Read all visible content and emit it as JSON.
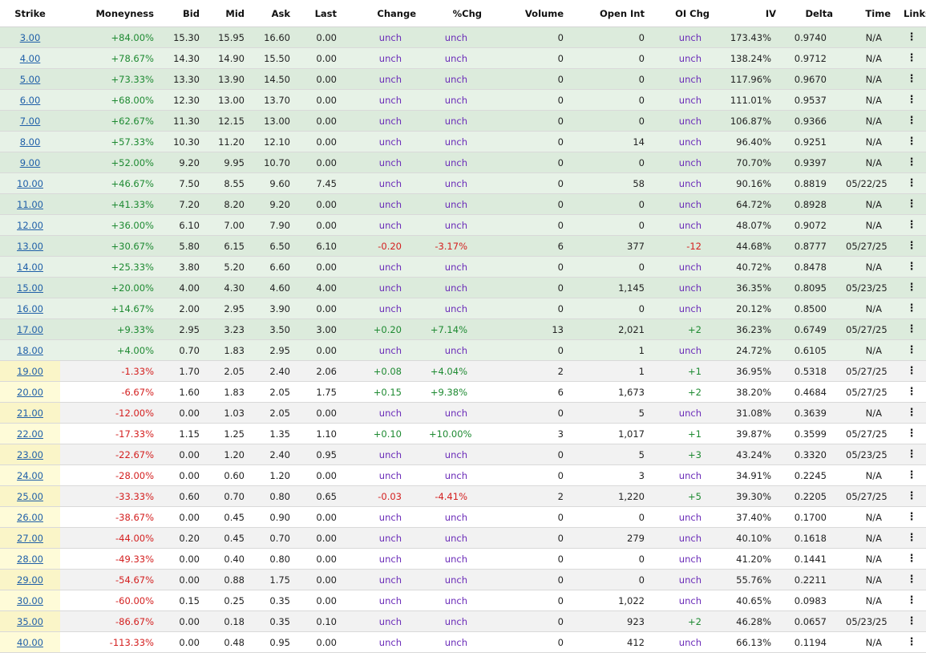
{
  "colors": {
    "positive": "#1e8a32",
    "negative": "#d42020",
    "unchanged": "#6a2bb8",
    "link": "#1f5fa8",
    "itm_bg": "#e7f2e7",
    "otm_strike_bg": "#fefbd8"
  },
  "columns": [
    "Strike",
    "Moneyness",
    "Bid",
    "Mid",
    "Ask",
    "Last",
    "Change",
    "%Chg",
    "Volume",
    "Open Int",
    "OI Chg",
    "IV",
    "Delta",
    "Time",
    "Links"
  ],
  "links_icon": "vertical-ellipsis-icon",
  "rows": [
    {
      "strike": "3.00",
      "moneyness": "+84.00%",
      "bid": "15.30",
      "mid": "15.95",
      "ask": "16.60",
      "last": "0.00",
      "change": "unch",
      "pct_chg": "unch",
      "volume": "0",
      "open_int": "0",
      "oi_chg": "unch",
      "iv": "173.43%",
      "delta": "0.9740",
      "time": "N/A",
      "links": "⋮"
    },
    {
      "strike": "4.00",
      "moneyness": "+78.67%",
      "bid": "14.30",
      "mid": "14.90",
      "ask": "15.50",
      "last": "0.00",
      "change": "unch",
      "pct_chg": "unch",
      "volume": "0",
      "open_int": "0",
      "oi_chg": "unch",
      "iv": "138.24%",
      "delta": "0.9712",
      "time": "N/A",
      "links": "⋮"
    },
    {
      "strike": "5.00",
      "moneyness": "+73.33%",
      "bid": "13.30",
      "mid": "13.90",
      "ask": "14.50",
      "last": "0.00",
      "change": "unch",
      "pct_chg": "unch",
      "volume": "0",
      "open_int": "0",
      "oi_chg": "unch",
      "iv": "117.96%",
      "delta": "0.9670",
      "time": "N/A",
      "links": "⋮"
    },
    {
      "strike": "6.00",
      "moneyness": "+68.00%",
      "bid": "12.30",
      "mid": "13.00",
      "ask": "13.70",
      "last": "0.00",
      "change": "unch",
      "pct_chg": "unch",
      "volume": "0",
      "open_int": "0",
      "oi_chg": "unch",
      "iv": "111.01%",
      "delta": "0.9537",
      "time": "N/A",
      "links": "⋮"
    },
    {
      "strike": "7.00",
      "moneyness": "+62.67%",
      "bid": "11.30",
      "mid": "12.15",
      "ask": "13.00",
      "last": "0.00",
      "change": "unch",
      "pct_chg": "unch",
      "volume": "0",
      "open_int": "0",
      "oi_chg": "unch",
      "iv": "106.87%",
      "delta": "0.9366",
      "time": "N/A",
      "links": "⋮"
    },
    {
      "strike": "8.00",
      "moneyness": "+57.33%",
      "bid": "10.30",
      "mid": "11.20",
      "ask": "12.10",
      "last": "0.00",
      "change": "unch",
      "pct_chg": "unch",
      "volume": "0",
      "open_int": "14",
      "oi_chg": "unch",
      "iv": "96.40%",
      "delta": "0.9251",
      "time": "N/A",
      "links": "⋮"
    },
    {
      "strike": "9.00",
      "moneyness": "+52.00%",
      "bid": "9.20",
      "mid": "9.95",
      "ask": "10.70",
      "last": "0.00",
      "change": "unch",
      "pct_chg": "unch",
      "volume": "0",
      "open_int": "0",
      "oi_chg": "unch",
      "iv": "70.70%",
      "delta": "0.9397",
      "time": "N/A",
      "links": "⋮"
    },
    {
      "strike": "10.00",
      "moneyness": "+46.67%",
      "bid": "7.50",
      "mid": "8.55",
      "ask": "9.60",
      "last": "7.45",
      "change": "unch",
      "pct_chg": "unch",
      "volume": "0",
      "open_int": "58",
      "oi_chg": "unch",
      "iv": "90.16%",
      "delta": "0.8819",
      "time": "05/22/25",
      "links": "⋮"
    },
    {
      "strike": "11.00",
      "moneyness": "+41.33%",
      "bid": "7.20",
      "mid": "8.20",
      "ask": "9.20",
      "last": "0.00",
      "change": "unch",
      "pct_chg": "unch",
      "volume": "0",
      "open_int": "0",
      "oi_chg": "unch",
      "iv": "64.72%",
      "delta": "0.8928",
      "time": "N/A",
      "links": "⋮"
    },
    {
      "strike": "12.00",
      "moneyness": "+36.00%",
      "bid": "6.10",
      "mid": "7.00",
      "ask": "7.90",
      "last": "0.00",
      "change": "unch",
      "pct_chg": "unch",
      "volume": "0",
      "open_int": "0",
      "oi_chg": "unch",
      "iv": "48.07%",
      "delta": "0.9072",
      "time": "N/A",
      "links": "⋮"
    },
    {
      "strike": "13.00",
      "moneyness": "+30.67%",
      "bid": "5.80",
      "mid": "6.15",
      "ask": "6.50",
      "last": "6.10",
      "change": "-0.20",
      "pct_chg": "-3.17%",
      "volume": "6",
      "open_int": "377",
      "oi_chg": "-12",
      "iv": "44.68%",
      "delta": "0.8777",
      "time": "05/27/25",
      "links": "⋮"
    },
    {
      "strike": "14.00",
      "moneyness": "+25.33%",
      "bid": "3.80",
      "mid": "5.20",
      "ask": "6.60",
      "last": "0.00",
      "change": "unch",
      "pct_chg": "unch",
      "volume": "0",
      "open_int": "0",
      "oi_chg": "unch",
      "iv": "40.72%",
      "delta": "0.8478",
      "time": "N/A",
      "links": "⋮"
    },
    {
      "strike": "15.00",
      "moneyness": "+20.00%",
      "bid": "4.00",
      "mid": "4.30",
      "ask": "4.60",
      "last": "4.00",
      "change": "unch",
      "pct_chg": "unch",
      "volume": "0",
      "open_int": "1,145",
      "oi_chg": "unch",
      "iv": "36.35%",
      "delta": "0.8095",
      "time": "05/23/25",
      "links": "⋮"
    },
    {
      "strike": "16.00",
      "moneyness": "+14.67%",
      "bid": "2.00",
      "mid": "2.95",
      "ask": "3.90",
      "last": "0.00",
      "change": "unch",
      "pct_chg": "unch",
      "volume": "0",
      "open_int": "0",
      "oi_chg": "unch",
      "iv": "20.12%",
      "delta": "0.8500",
      "time": "N/A",
      "links": "⋮"
    },
    {
      "strike": "17.00",
      "moneyness": "+9.33%",
      "bid": "2.95",
      "mid": "3.23",
      "ask": "3.50",
      "last": "3.00",
      "change": "+0.20",
      "pct_chg": "+7.14%",
      "volume": "13",
      "open_int": "2,021",
      "oi_chg": "+2",
      "iv": "36.23%",
      "delta": "0.6749",
      "time": "05/27/25",
      "links": "⋮"
    },
    {
      "strike": "18.00",
      "moneyness": "+4.00%",
      "bid": "0.70",
      "mid": "1.83",
      "ask": "2.95",
      "last": "0.00",
      "change": "unch",
      "pct_chg": "unch",
      "volume": "0",
      "open_int": "1",
      "oi_chg": "unch",
      "iv": "24.72%",
      "delta": "0.6105",
      "time": "N/A",
      "links": "⋮"
    },
    {
      "strike": "19.00",
      "moneyness": "-1.33%",
      "bid": "1.70",
      "mid": "2.05",
      "ask": "2.40",
      "last": "2.06",
      "change": "+0.08",
      "pct_chg": "+4.04%",
      "volume": "2",
      "open_int": "1",
      "oi_chg": "+1",
      "iv": "36.95%",
      "delta": "0.5318",
      "time": "05/27/25",
      "links": "⋮"
    },
    {
      "strike": "20.00",
      "moneyness": "-6.67%",
      "bid": "1.60",
      "mid": "1.83",
      "ask": "2.05",
      "last": "1.75",
      "change": "+0.15",
      "pct_chg": "+9.38%",
      "volume": "6",
      "open_int": "1,673",
      "oi_chg": "+2",
      "iv": "38.20%",
      "delta": "0.4684",
      "time": "05/27/25",
      "links": "⋮"
    },
    {
      "strike": "21.00",
      "moneyness": "-12.00%",
      "bid": "0.00",
      "mid": "1.03",
      "ask": "2.05",
      "last": "0.00",
      "change": "unch",
      "pct_chg": "unch",
      "volume": "0",
      "open_int": "5",
      "oi_chg": "unch",
      "iv": "31.08%",
      "delta": "0.3639",
      "time": "N/A",
      "links": "⋮"
    },
    {
      "strike": "22.00",
      "moneyness": "-17.33%",
      "bid": "1.15",
      "mid": "1.25",
      "ask": "1.35",
      "last": "1.10",
      "change": "+0.10",
      "pct_chg": "+10.00%",
      "volume": "3",
      "open_int": "1,017",
      "oi_chg": "+1",
      "iv": "39.87%",
      "delta": "0.3599",
      "time": "05/27/25",
      "links": "⋮"
    },
    {
      "strike": "23.00",
      "moneyness": "-22.67%",
      "bid": "0.00",
      "mid": "1.20",
      "ask": "2.40",
      "last": "0.95",
      "change": "unch",
      "pct_chg": "unch",
      "volume": "0",
      "open_int": "5",
      "oi_chg": "+3",
      "iv": "43.24%",
      "delta": "0.3320",
      "time": "05/23/25",
      "links": "⋮"
    },
    {
      "strike": "24.00",
      "moneyness": "-28.00%",
      "bid": "0.00",
      "mid": "0.60",
      "ask": "1.20",
      "last": "0.00",
      "change": "unch",
      "pct_chg": "unch",
      "volume": "0",
      "open_int": "3",
      "oi_chg": "unch",
      "iv": "34.91%",
      "delta": "0.2245",
      "time": "N/A",
      "links": "⋮"
    },
    {
      "strike": "25.00",
      "moneyness": "-33.33%",
      "bid": "0.60",
      "mid": "0.70",
      "ask": "0.80",
      "last": "0.65",
      "change": "-0.03",
      "pct_chg": "-4.41%",
      "volume": "2",
      "open_int": "1,220",
      "oi_chg": "+5",
      "iv": "39.30%",
      "delta": "0.2205",
      "time": "05/27/25",
      "links": "⋮"
    },
    {
      "strike": "26.00",
      "moneyness": "-38.67%",
      "bid": "0.00",
      "mid": "0.45",
      "ask": "0.90",
      "last": "0.00",
      "change": "unch",
      "pct_chg": "unch",
      "volume": "0",
      "open_int": "0",
      "oi_chg": "unch",
      "iv": "37.40%",
      "delta": "0.1700",
      "time": "N/A",
      "links": "⋮"
    },
    {
      "strike": "27.00",
      "moneyness": "-44.00%",
      "bid": "0.20",
      "mid": "0.45",
      "ask": "0.70",
      "last": "0.00",
      "change": "unch",
      "pct_chg": "unch",
      "volume": "0",
      "open_int": "279",
      "oi_chg": "unch",
      "iv": "40.10%",
      "delta": "0.1618",
      "time": "N/A",
      "links": "⋮"
    },
    {
      "strike": "28.00",
      "moneyness": "-49.33%",
      "bid": "0.00",
      "mid": "0.40",
      "ask": "0.80",
      "last": "0.00",
      "change": "unch",
      "pct_chg": "unch",
      "volume": "0",
      "open_int": "0",
      "oi_chg": "unch",
      "iv": "41.20%",
      "delta": "0.1441",
      "time": "N/A",
      "links": "⋮"
    },
    {
      "strike": "29.00",
      "moneyness": "-54.67%",
      "bid": "0.00",
      "mid": "0.88",
      "ask": "1.75",
      "last": "0.00",
      "change": "unch",
      "pct_chg": "unch",
      "volume": "0",
      "open_int": "0",
      "oi_chg": "unch",
      "iv": "55.76%",
      "delta": "0.2211",
      "time": "N/A",
      "links": "⋮"
    },
    {
      "strike": "30.00",
      "moneyness": "-60.00%",
      "bid": "0.15",
      "mid": "0.25",
      "ask": "0.35",
      "last": "0.00",
      "change": "unch",
      "pct_chg": "unch",
      "volume": "0",
      "open_int": "1,022",
      "oi_chg": "unch",
      "iv": "40.65%",
      "delta": "0.0983",
      "time": "N/A",
      "links": "⋮"
    },
    {
      "strike": "35.00",
      "moneyness": "-86.67%",
      "bid": "0.00",
      "mid": "0.18",
      "ask": "0.35",
      "last": "0.10",
      "change": "unch",
      "pct_chg": "unch",
      "volume": "0",
      "open_int": "923",
      "oi_chg": "+2",
      "iv": "46.28%",
      "delta": "0.0657",
      "time": "05/23/25",
      "links": "⋮"
    },
    {
      "strike": "40.00",
      "moneyness": "-113.33%",
      "bid": "0.00",
      "mid": "0.48",
      "ask": "0.95",
      "last": "0.00",
      "change": "unch",
      "pct_chg": "unch",
      "volume": "0",
      "open_int": "412",
      "oi_chg": "unch",
      "iv": "66.13%",
      "delta": "0.1194",
      "time": "N/A",
      "links": "⋮"
    }
  ]
}
